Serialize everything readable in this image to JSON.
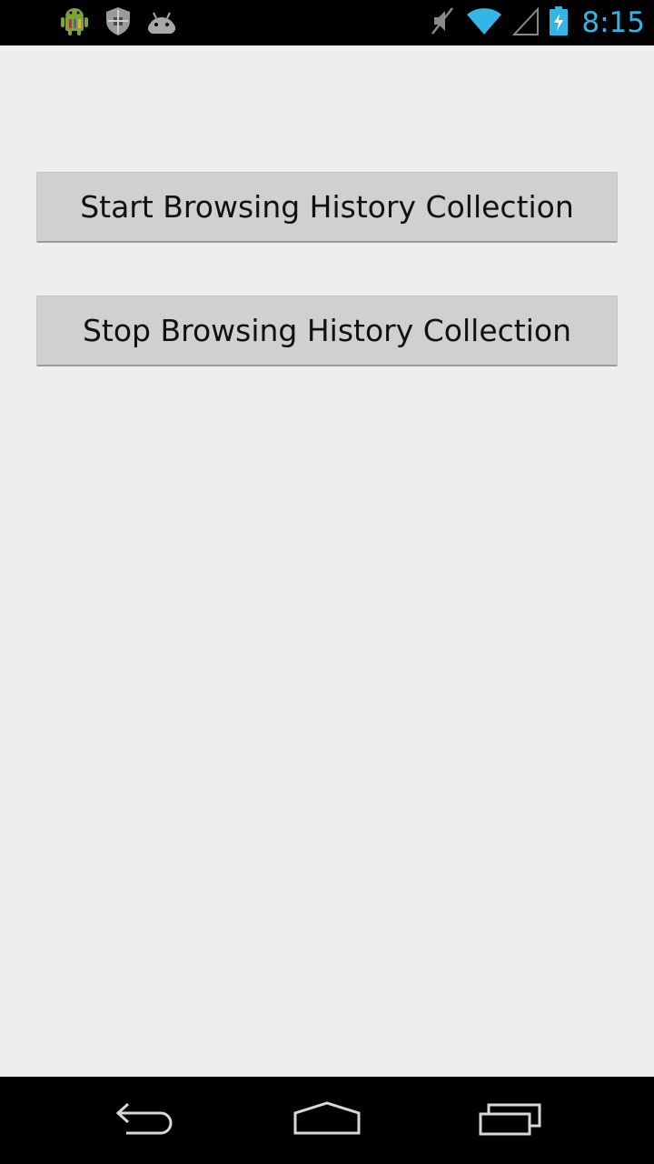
{
  "status_bar": {
    "time": "8:15",
    "clock_color": "#33b5e5",
    "notification_icons": [
      "android-robot-icon",
      "security-shield-icon",
      "android-head-icon"
    ],
    "system_icons": [
      "vibrate-muted-icon",
      "wifi-icon",
      "signal-icon",
      "battery-charging-icon"
    ]
  },
  "main": {
    "start_button_label": "Start Browsing History Collection",
    "stop_button_label": "Stop Browsing History Collection"
  },
  "nav_bar": {
    "buttons": [
      "back-icon",
      "home-icon",
      "recents-icon"
    ]
  }
}
